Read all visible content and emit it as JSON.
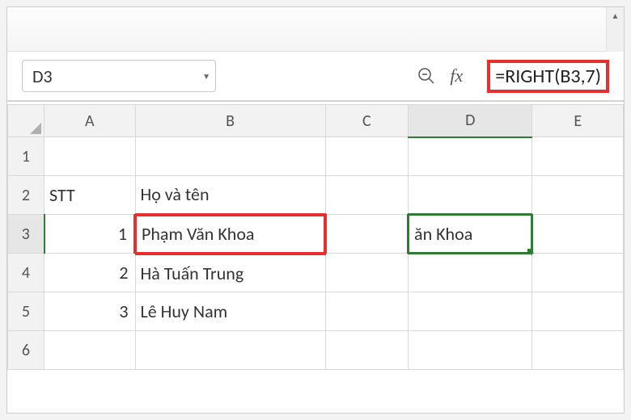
{
  "name_box": {
    "value": "D3"
  },
  "formula_bar": {
    "formula": "=RIGHT(B3,7)"
  },
  "columns": [
    "A",
    "B",
    "C",
    "D",
    "E"
  ],
  "row_headers": [
    "1",
    "2",
    "3",
    "4",
    "5",
    "6"
  ],
  "grid": {
    "A2": "STT",
    "B2": "Họ và tên",
    "A3": "1",
    "B3": "Phạm Văn Khoa",
    "D3": "ăn Khoa",
    "A4": "2",
    "B4": "Hà Tuấn Trung",
    "A5": "3",
    "B5": "Lê Huy Nam"
  },
  "selection": {
    "cell": "D3",
    "col": "D",
    "row": "3"
  },
  "highlights": {
    "red_cells": [
      "B3",
      "D3"
    ],
    "red_formula": true
  }
}
